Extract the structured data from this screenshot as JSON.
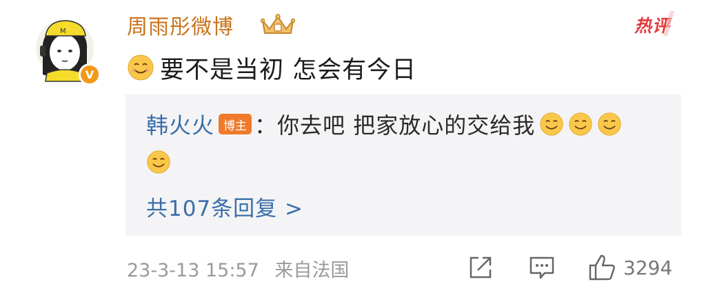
{
  "comment": {
    "username": "周雨彤微博",
    "main_text": "要不是当初 怎会有今日",
    "hot_label": "热评",
    "verified_badge": "V",
    "avatar_letter": "M"
  },
  "reply": {
    "username": "韩火火",
    "badge": "博主",
    "text": "：你去吧 把家放心的交给我",
    "emoji_count": 4
  },
  "more_replies": "共107条回复 >",
  "footer": {
    "date": "23-3-13 15:57",
    "location": "来自法国",
    "like_count": "3294"
  },
  "icons": [
    "avatar-icon",
    "verified-icon",
    "crown-icon",
    "smile-emoji-icon",
    "share-icon",
    "comment-icon",
    "like-icon"
  ],
  "colors": {
    "username": "#c9731a",
    "hot": "#e43b3b",
    "link": "#3a6ea8",
    "badge_bg": "#f07a2b",
    "reply_bg": "#f4f4f6",
    "meta": "#9a9a9a"
  }
}
